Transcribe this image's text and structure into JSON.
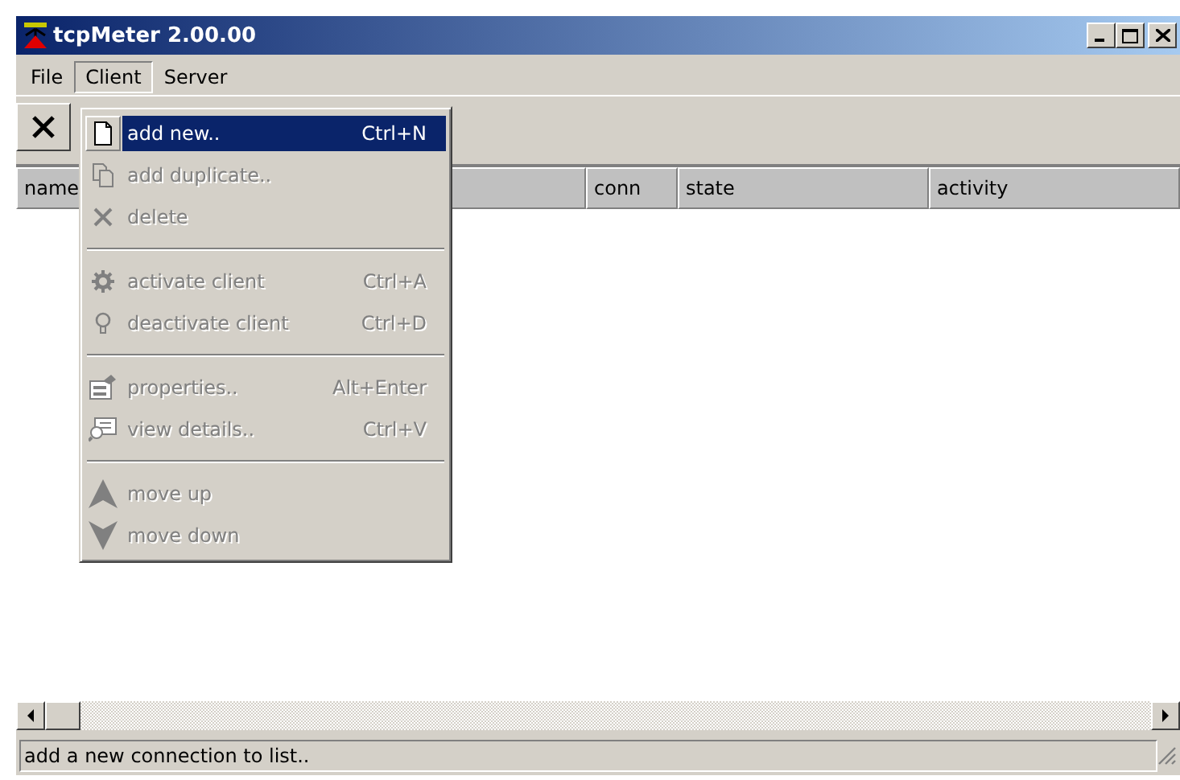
{
  "window": {
    "title": "tcpMeter 2.00.00"
  },
  "menu_bar": [
    {
      "label": "File",
      "selected": false
    },
    {
      "label": "Client",
      "selected": true
    },
    {
      "label": "Server",
      "selected": false
    }
  ],
  "toolbar": {
    "buttons": [
      {
        "kind": "delete"
      }
    ]
  },
  "table": {
    "columns": [
      {
        "label": "name"
      },
      {
        "label": "conn"
      },
      {
        "label": "state"
      },
      {
        "label": "activity"
      }
    ]
  },
  "status_bar": "add a new connection to list..",
  "client_menu": [
    {
      "kind": "item",
      "label": "add new..",
      "shortcut": "Ctrl+N",
      "disabled": false,
      "selected": true
    },
    {
      "kind": "item",
      "label": "add duplicate..",
      "disabled": true,
      "selected": false
    },
    {
      "kind": "item",
      "label": "delete",
      "disabled": true,
      "selected": false
    },
    {
      "kind": "separator"
    },
    {
      "kind": "item",
      "label": "activate client",
      "shortcut": "Ctrl+A",
      "disabled": true,
      "selected": false
    },
    {
      "kind": "item",
      "label": "deactivate client",
      "shortcut": "Ctrl+D",
      "disabled": true,
      "selected": false
    },
    {
      "kind": "separator"
    },
    {
      "kind": "item",
      "label": "properties..",
      "shortcut": "Alt+Enter",
      "disabled": true,
      "selected": false
    },
    {
      "kind": "item",
      "label": "view details..",
      "shortcut": "Ctrl+V",
      "disabled": true,
      "selected": false
    },
    {
      "kind": "separator"
    },
    {
      "kind": "item",
      "label": "move up",
      "disabled": true,
      "selected": false
    },
    {
      "kind": "item",
      "label": "move down",
      "disabled": true,
      "selected": false
    }
  ]
}
